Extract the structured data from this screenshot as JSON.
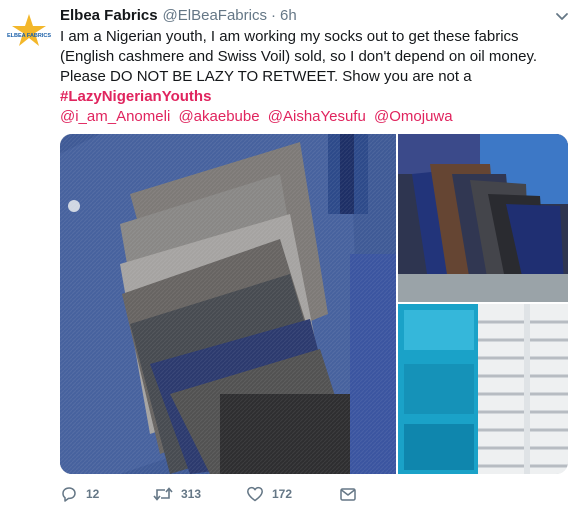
{
  "avatar": {
    "logo_text": "ELBEA FABRICS"
  },
  "tweet": {
    "display_name": "Elbea Fabrics",
    "handle": "@ElBeaFabrics",
    "separator": "·",
    "time": "6h",
    "text_prefix": "I am a Nigerian youth, I am working my socks out to get these fabrics (English cashmere and Swiss Voil) sold, so I don't depend on oil money. Please DO NOT BE LAZY TO RETWEET. Show you are not a ",
    "hashtag": "#LazyNigerianYouths",
    "mentions": [
      "@i_am_Anomeli",
      "@akaebube",
      "@AishaYesufu",
      "@Omojuwa"
    ]
  },
  "actions": {
    "replies": "12",
    "retweets": "313",
    "likes": "172"
  },
  "colors": {
    "accent": "#e0245e",
    "muted": "#657786",
    "text": "#14171a"
  }
}
